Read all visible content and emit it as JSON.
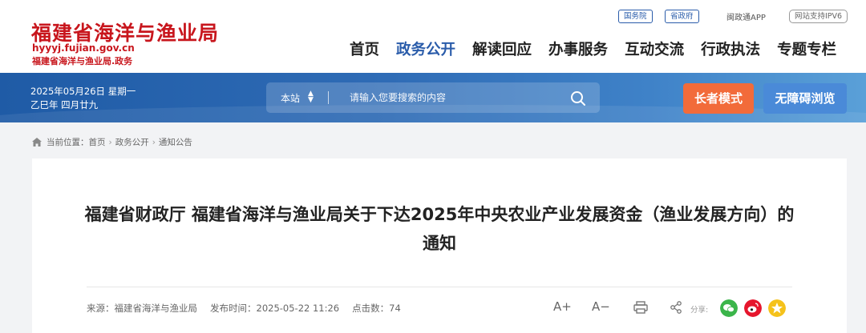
{
  "header": {
    "site_title": "福建省海洋与渔业局",
    "domain": "hyyyj.fujian.gov.cn",
    "domain_cn": "福建省海洋与渔业局.政务",
    "top_links": [
      "国务院",
      "省政府"
    ],
    "app_link": "闽政通APP",
    "ipv6_badge": "网站支持IPV6"
  },
  "nav": [
    "首页",
    "政务公开",
    "解读回应",
    "办事服务",
    "互动交流",
    "行政执法",
    "专题专栏"
  ],
  "banner": {
    "date_line1": "2025年05月26日 星期一",
    "date_line2": "乙巳年 四月廿九",
    "search_scope": "本站",
    "search_placeholder": "请输入您要搜索的内容",
    "elder_mode": "长者模式",
    "accessible": "无障碍浏览"
  },
  "breadcrumb": {
    "prefix": "当前位置：",
    "items": [
      "首页",
      "政务公开",
      "通知公告"
    ]
  },
  "article": {
    "title": "福建省财政厅 福建省海洋与渔业局关于下达2025年中央农业产业发展资金（渔业发展方向）的通知",
    "source": "来源：福建省海洋与渔业局",
    "publish_time": "发布时间：2025-05-22 11:26",
    "clicks": "点击数：74",
    "font_increase": "A+",
    "font_decrease": "A−",
    "share_label": "分享:"
  },
  "colors": {
    "brand_red": "#c8161d",
    "nav_active": "#2a5caa",
    "elder_btn": "#f26b3a",
    "access_btn": "#4a8ad8",
    "wechat": "#3bb54a",
    "weibo": "#e6162d",
    "qzone": "#f5c21b"
  }
}
